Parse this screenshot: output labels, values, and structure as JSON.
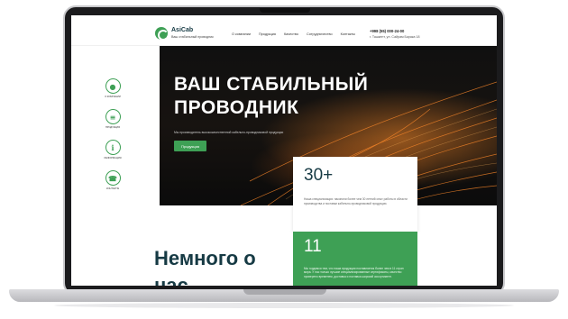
{
  "header": {
    "brand": "AsiCab",
    "tagline": "Ваш стабильный проводник",
    "nav": [
      "О компании",
      "Продукция",
      "Качество",
      "Сотрудничество",
      "Контакты"
    ],
    "phone": "+998 (55) 000-24-00",
    "address": "г. Ташкент, ул. Сайрам Барака 18"
  },
  "hero": {
    "title": "ВАШ СТАБИЛЬНЫЙ ПРОВОДНИК",
    "subtitle": "Мы производитель высококачественной кабельно-проводниковой продукции",
    "button": "Продукция"
  },
  "side_nav": [
    {
      "icon": "group-icon",
      "label": "О компании"
    },
    {
      "icon": "list-icon",
      "label": "Продукция"
    },
    {
      "icon": "info-icon",
      "label": "Информация"
    },
    {
      "icon": "phone-icon",
      "label": "Контакты"
    }
  ],
  "stats": [
    {
      "value": "30+",
      "text": "Наша специализация: накопили более чем 30 летний опыт работы в области производства и поставки кабельно-проводниковой продукции."
    },
    {
      "value": "11",
      "text": "Мы гордимся тем, что наша продукция поставляется более чем в 11 стран мира. У нас только лучшие специализированные сертификаты, качество проверено временем, доставка и поставка широкий ассортимент."
    }
  ],
  "about": {
    "heading": "Немного о нас"
  },
  "colors": {
    "accent": "#3ea055",
    "dark_text": "#163a44"
  }
}
